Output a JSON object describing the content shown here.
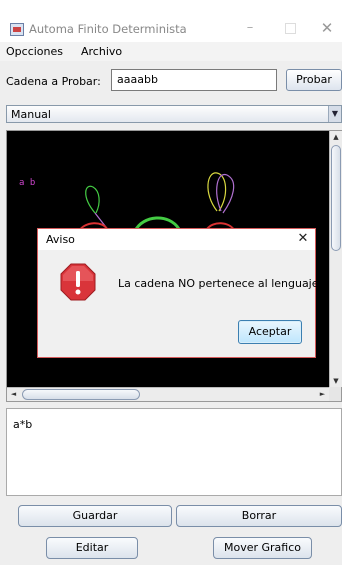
{
  "window": {
    "title": "Automa Finito Determinista",
    "minimize_glyph": "–",
    "close_glyph": "✕"
  },
  "menu": {
    "items": [
      {
        "label": "Opcciones"
      },
      {
        "label": "Archivo"
      }
    ]
  },
  "input_row": {
    "label": "Cadena a Probar:",
    "value": "aaaabb",
    "button_label": "Probar"
  },
  "mode_select": {
    "selected": "Manual",
    "arrow_glyph": "▼"
  },
  "graph_canvas": {
    "label": "a b",
    "background": "#000000",
    "scroll_up_glyph": "▲",
    "scroll_down_glyph": "▼",
    "scroll_left_glyph": "◄",
    "scroll_right_glyph": "►"
  },
  "dialog": {
    "title": "Aviso",
    "close_glyph": "✕",
    "icon": "error-octagon-icon",
    "message": "La cadena NO pertenece al lenguaje",
    "button_label": "Aceptar",
    "accent_color": "#d9343a"
  },
  "regex_area": {
    "text": "a*b"
  },
  "buttons": {
    "guardar": "Guardar",
    "borrar": "Borrar",
    "editar": "Editar",
    "mover": "Mover Grafico"
  }
}
